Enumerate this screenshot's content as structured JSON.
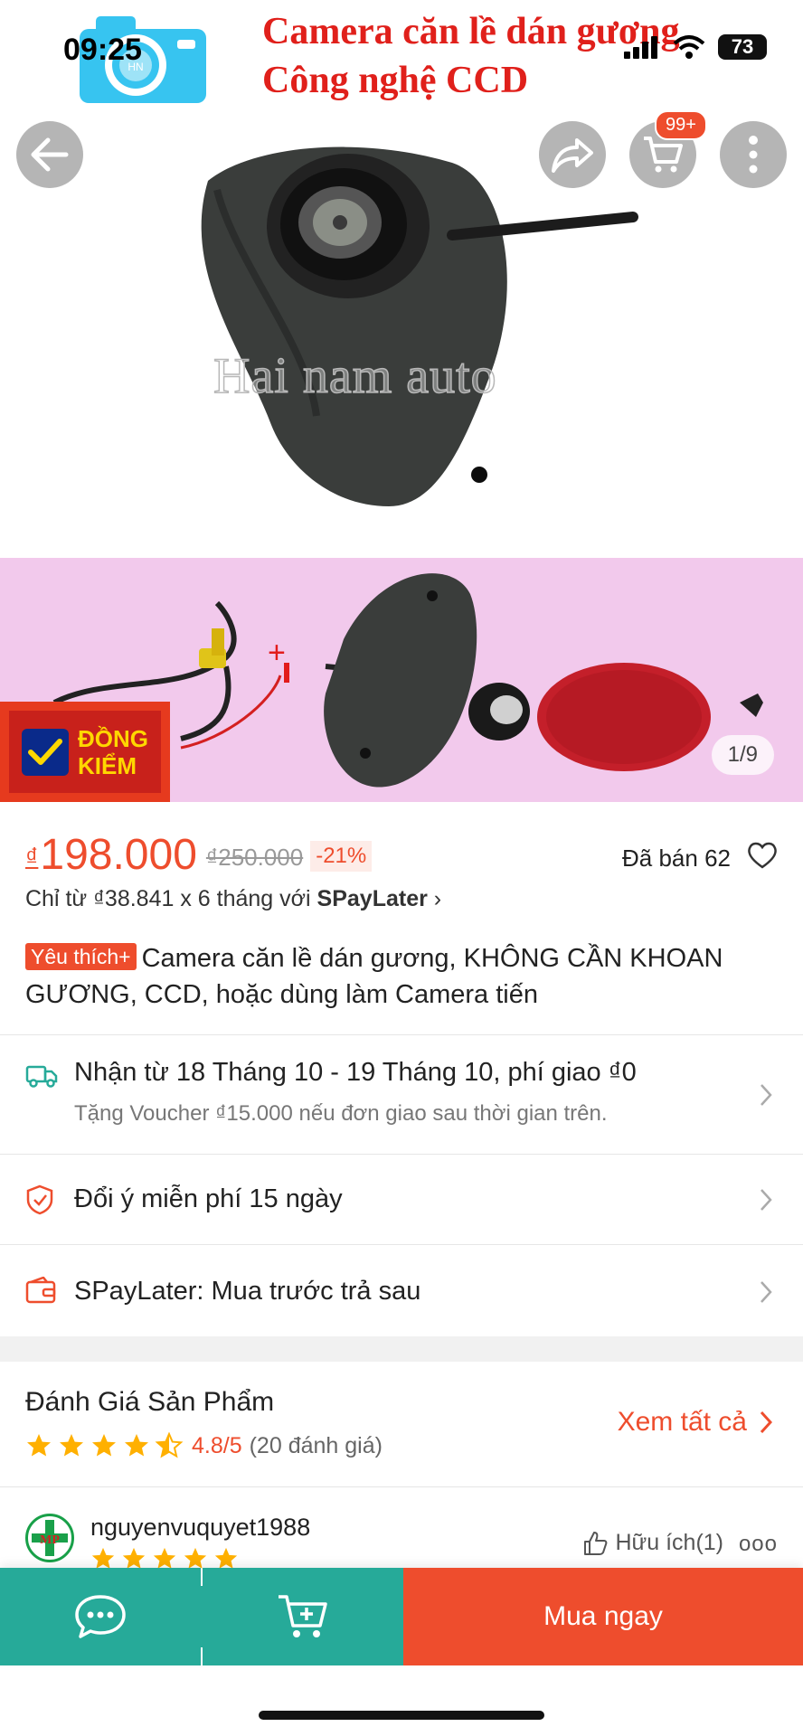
{
  "status_bar": {
    "time": "09:25",
    "battery": "73"
  },
  "hero": {
    "title_line1": "Camera căn lề dán gương",
    "title_line2": "Công nghệ CCD",
    "logo_text": "HN",
    "watermark": "Hai nam auto"
  },
  "nav": {
    "cart_badge": "99+"
  },
  "banner": {
    "badge_line1": "ĐỒNG",
    "badge_line2": "KIỂM",
    "pager": "1/9"
  },
  "price": {
    "currency": "₫",
    "current": "198.000",
    "original": "₫250.000",
    "discount": "-21%",
    "sold": "Đã bán 62",
    "paylater_prefix": "Chỉ từ ₫38.841 x 6 tháng với",
    "paylater_brand": "SPayLater"
  },
  "product": {
    "tag": "Yêu thích+",
    "title": "Camera căn lề dán gương, KHÔNG CẦN KHOAN GƯƠNG, CCD, hoặc dùng làm Camera tiến"
  },
  "shipping": {
    "main": "Nhận từ 18 Tháng 10 - 19 Tháng 10, phí giao ₫0",
    "sub": "Tặng Voucher ₫15.000 nếu đơn giao sau thời gian trên."
  },
  "returns": {
    "label": "Đổi ý miễn phí 15 ngày"
  },
  "spaylater": {
    "label": "SPayLater: Mua trước trả sau"
  },
  "reviews": {
    "heading": "Đánh Giá Sản Phẩm",
    "rating": 4.8,
    "score": "4.8/5",
    "count": "(20 đánh giá)",
    "see_all": "Xem tất cả"
  },
  "review_item": {
    "username": "nguyenvuquyet1988",
    "avatar_text": "MP",
    "stars": 5,
    "helpful": "Hữu ích(1)",
    "more": "ooo"
  },
  "bottom_bar": {
    "buy_label": "Mua ngay"
  },
  "colors": {
    "accent": "#ee4d2d",
    "teal": "#26aa99",
    "banner_bg": "#f2c9ec"
  }
}
